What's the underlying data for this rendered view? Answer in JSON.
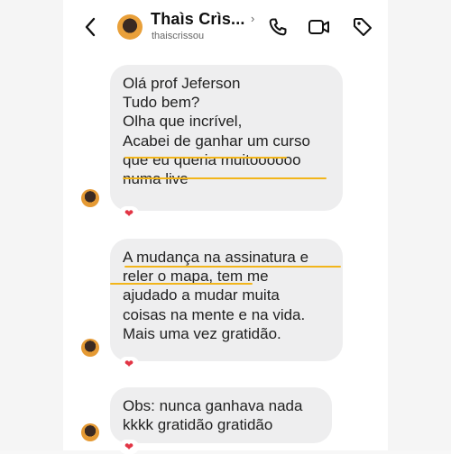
{
  "header": {
    "name": "Thaìs Crìs...",
    "username": "thaiscrissou",
    "chevron": "›",
    "icons": [
      "back-chevron-icon",
      "phone-icon",
      "video-camera-icon",
      "tag-icon"
    ]
  },
  "messages": [
    {
      "text": "Olá prof Jeferson\nTudo bem?\nOlha que incrível,\nAcabei de ganhar um curso\nque eu queria muitoooooo\nnuma live",
      "reaction": "❤"
    },
    {
      "text": "A mudança na assinatura e\nreler o mapa, tem me\najudado a mudar muita\ncoisas na mente e na vida.\nMais uma vez gratidão.",
      "reaction": "❤"
    },
    {
      "text": "Obs: nunca ganhava nada\nkkkk gratidão gratidão",
      "reaction": "❤"
    }
  ],
  "colors": {
    "bubble": "#eeeeef",
    "highlight_underline": "#f2b51b",
    "heart": "#e23545",
    "text": "#222222"
  }
}
